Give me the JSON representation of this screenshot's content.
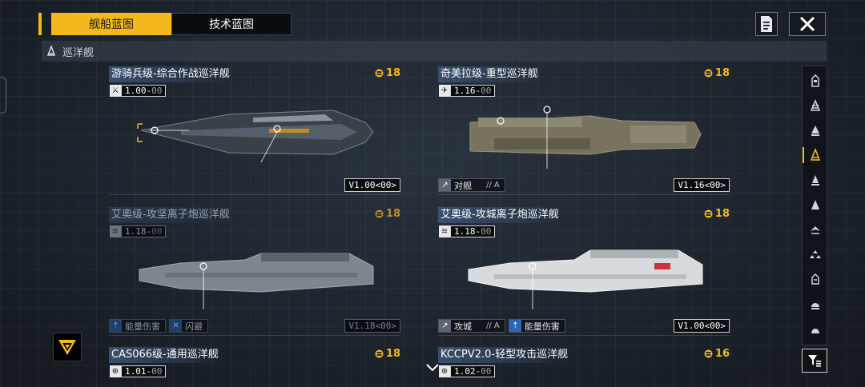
{
  "tabs": [
    {
      "label": "舰船蓝图",
      "active": true
    },
    {
      "label": "技术蓝图",
      "active": false
    }
  ],
  "category": {
    "label": "巡洋舰",
    "icon": "cruiser-icon"
  },
  "colors": {
    "accent": "#f5b81c",
    "info_blue": "#2a68b4",
    "title_bg": "#3a4f6f"
  },
  "cards": [
    {
      "title": "游骑兵级-综合作战巡洋舰",
      "cost": "18",
      "version_icon": "dagger-icon",
      "version": "1.00",
      "version_suffix": "00",
      "build_version": "V1.00<00>",
      "dim": false,
      "tags": []
    },
    {
      "title": "奇美拉级-重型巡洋舰",
      "cost": "18",
      "version_icon": "jet-icon",
      "version": "1.16",
      "version_suffix": "00",
      "build_version": "V1.16<00>",
      "dim": false,
      "tags": [
        {
          "icon": "anti-ship-icon",
          "label": "对舰",
          "sub": "// A",
          "icon_color": "grey"
        }
      ]
    },
    {
      "title": "艾奥级-攻坚离子炮巡洋舰",
      "cost": "18",
      "version_icon": "ion-cannon-icon",
      "version": "1.18",
      "version_suffix": "00",
      "build_version": "V1.18<00>",
      "dim": true,
      "tags": [
        {
          "icon": "energy-damage-icon",
          "label": "能量伤害",
          "sub": "",
          "icon_color": "blue"
        },
        {
          "icon": "dodge-icon",
          "label": "闪避",
          "sub": "",
          "icon_color": "blue"
        }
      ]
    },
    {
      "title": "艾奥级-攻城离子炮巡洋舰",
      "cost": "18",
      "version_icon": "ion-cannon-icon",
      "version": "1.18",
      "version_suffix": "00",
      "build_version": "V1.00<00>",
      "dim": false,
      "tags": [
        {
          "icon": "siege-icon",
          "label": "攻城",
          "sub": "// A",
          "icon_color": "grey"
        },
        {
          "icon": "energy-damage-icon",
          "label": "能量伤害",
          "sub": "",
          "icon_color": "blue"
        }
      ]
    },
    {
      "title": "CAS066级-通用巡洋舰",
      "cost": "18",
      "version_icon": "globe-icon",
      "version": "1.01",
      "version_suffix": "00",
      "dim": false
    },
    {
      "title": "KCCPV2.0-轻型攻击巡洋舰",
      "cost": "16",
      "version_icon": "globe-icon",
      "version": "1.02",
      "version_suffix": "00",
      "dim": false
    }
  ],
  "sidebar": {
    "items": [
      {
        "icon": "carrier-icon",
        "active": false
      },
      {
        "icon": "battlecruiser-icon",
        "active": false
      },
      {
        "icon": "destroyer-icon",
        "active": false
      },
      {
        "icon": "cruiser-icon",
        "active": true
      },
      {
        "icon": "frigate-icon",
        "active": false
      },
      {
        "icon": "corvette-icon",
        "active": false
      },
      {
        "icon": "fighter-icon",
        "active": false
      },
      {
        "icon": "drone-icon",
        "active": false
      },
      {
        "icon": "auxiliary-icon",
        "active": false
      },
      {
        "icon": "support-icon",
        "active": false
      },
      {
        "icon": "utility-icon",
        "active": false
      }
    ]
  }
}
